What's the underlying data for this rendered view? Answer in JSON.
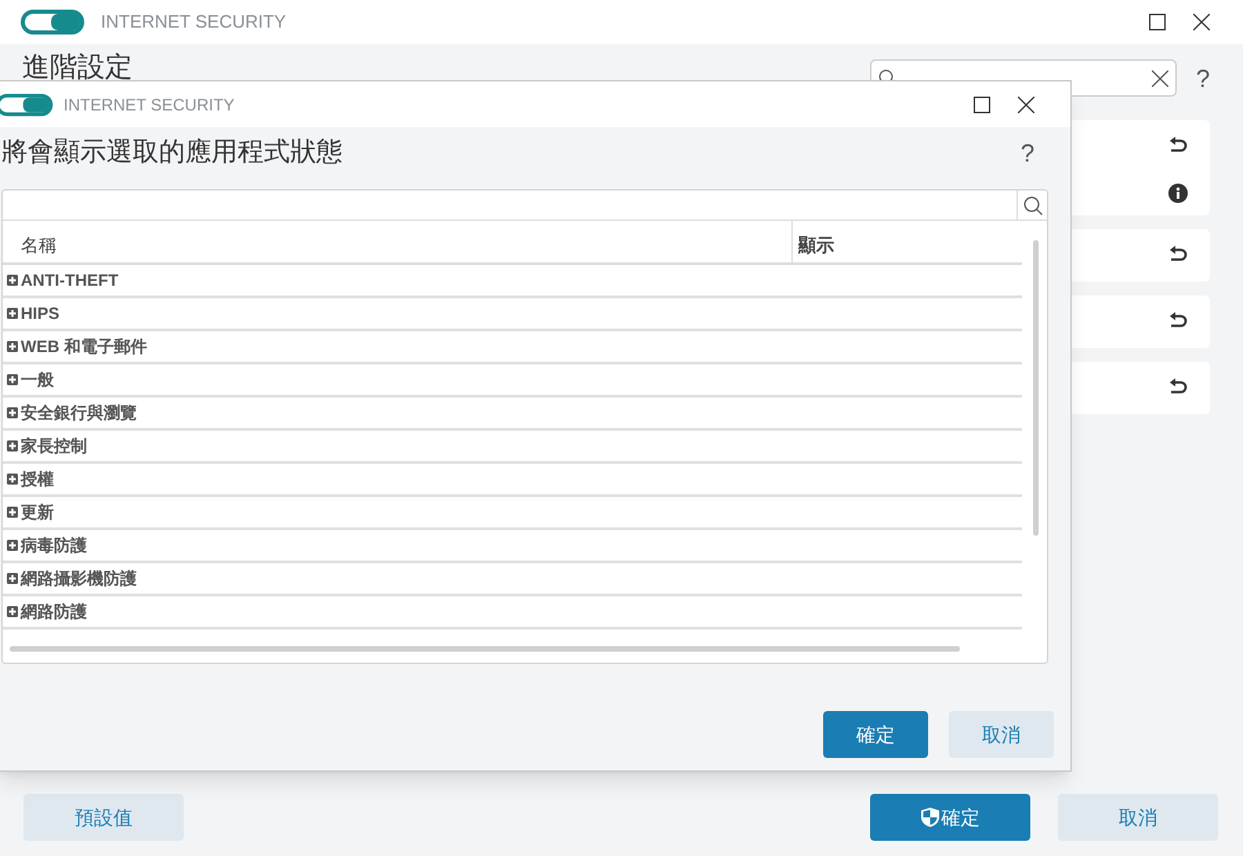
{
  "main_window": {
    "title": "INTERNET SECURITY",
    "heading": "進階設定",
    "help": "?",
    "cards": [
      {
        "info": true
      },
      {
        "info": false
      },
      {
        "info": false
      },
      {
        "info": false
      }
    ],
    "buttons": [
      {
        "kind": "default",
        "label": "預設值"
      },
      {
        "kind": "ok",
        "label": "確定"
      },
      {
        "kind": "cancel",
        "label": "取消"
      }
    ]
  },
  "dialog": {
    "title": "INTERNET SECURITY",
    "heading": "將會顯示選取的應用程式狀態",
    "help": "?",
    "table": {
      "columns": [
        "名稱",
        "顯示"
      ],
      "rows": [
        {
          "name": "ANTI-THEFT",
          "expanded": false
        },
        {
          "name": "HIPS",
          "expanded": false
        },
        {
          "name": "WEB 和電子郵件",
          "expanded": false
        },
        {
          "name": "一般",
          "expanded": false
        },
        {
          "name": "安全銀行與瀏覽",
          "expanded": false
        },
        {
          "name": "家長控制",
          "expanded": false
        },
        {
          "name": "授權",
          "expanded": false
        },
        {
          "name": "更新",
          "expanded": false
        },
        {
          "name": "病毒防護",
          "expanded": false
        },
        {
          "name": "網路攝影機防護",
          "expanded": false
        },
        {
          "name": "網路防護",
          "expanded": false
        }
      ]
    },
    "buttons": [
      {
        "kind": "ok",
        "label": "確定"
      },
      {
        "kind": "cancel",
        "label": "取消"
      }
    ]
  }
}
